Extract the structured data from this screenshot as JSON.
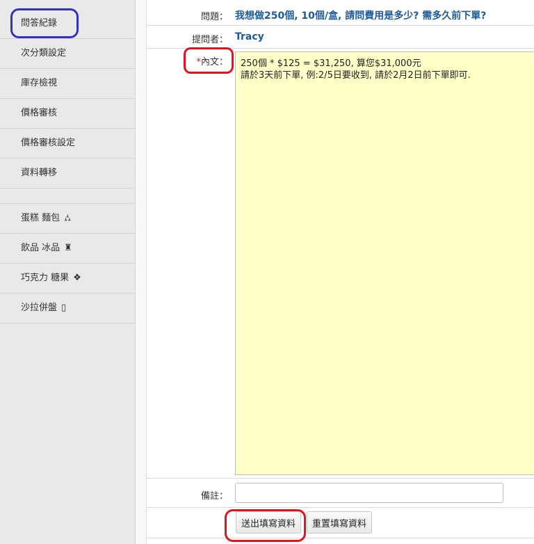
{
  "sidebar": {
    "items": [
      {
        "label": "問答紀錄",
        "icon": ""
      },
      {
        "label": "次分類設定",
        "icon": ""
      },
      {
        "label": "庫存檢視",
        "icon": ""
      },
      {
        "label": "價格審核",
        "icon": ""
      },
      {
        "label": "價格審核設定",
        "icon": ""
      },
      {
        "label": "資料轉移",
        "icon": ""
      }
    ],
    "categories": [
      {
        "label": "蛋糕 麵包",
        "icon": "⛼",
        "icon_name": "cake-icon"
      },
      {
        "label": "飲品 冰品",
        "icon": "♜",
        "icon_name": "drink-icon"
      },
      {
        "label": "巧克力 糖果",
        "icon": "❖",
        "icon_name": "candy-icon"
      },
      {
        "label": "沙拉併盤",
        "icon": "▯",
        "icon_name": "salad-icon"
      }
    ]
  },
  "form": {
    "question_label": "問題：",
    "question_value": "我想做250個, 10個/盒, 請問費用是多少? 需多久前下單?",
    "asker_label": "提問者：",
    "asker_value": "Tracy",
    "content_required_mark": "*",
    "content_label": "內文：",
    "content_value": "250個 * $125 = $31,250, 算您$31,000元\n請於3天前下單, 例:2/5日要收到, 請於2月2日前下單即可.",
    "remark_label": "備註：",
    "remark_value": "",
    "submit_label": "送出填寫資料",
    "reset_label": "重置填寫資料"
  },
  "colors": {
    "question_text": "#1e5b9a",
    "content_bg": "#ffffc8",
    "highlight_red": "#e0141f",
    "highlight_blue": "#3232c8"
  }
}
